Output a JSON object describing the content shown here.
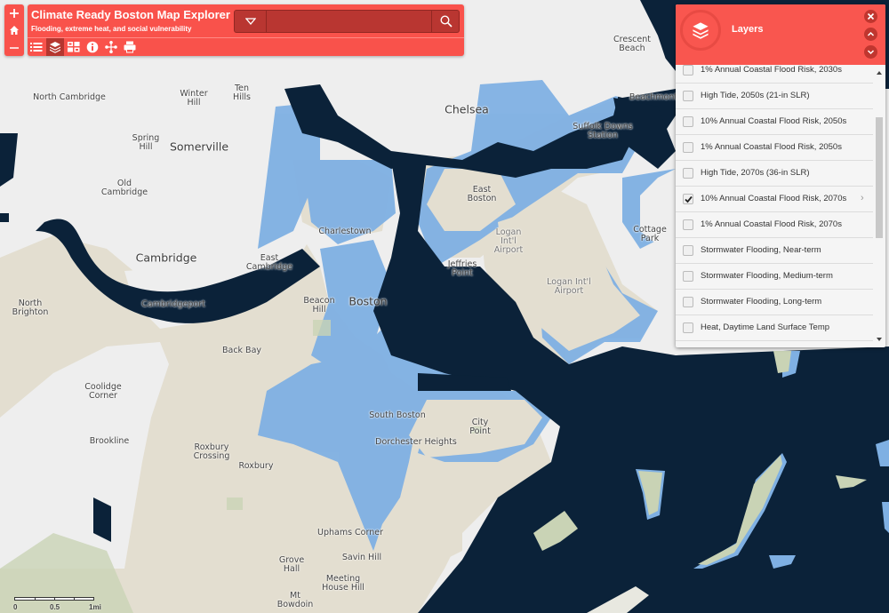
{
  "app": {
    "title": "Climate Ready Boston Map Explorer",
    "subtitle": "Flooding, extreme heat, and social vulnerability",
    "accent_color": "#f9524b",
    "accent_dark": "#b5362f"
  },
  "zoom_control": {
    "zoom_in_icon": "plus-icon",
    "home_icon": "home-icon",
    "zoom_out_icon": "minus-icon"
  },
  "search": {
    "value": "",
    "placeholder": "",
    "dropdown_icon": "triangle-down-icon",
    "search_icon": "magnifier-icon"
  },
  "toolbar": {
    "tools": [
      {
        "name": "legend",
        "icon": "list-icon",
        "active": false
      },
      {
        "name": "layers",
        "icon": "layers-icon",
        "active": true
      },
      {
        "name": "basemap",
        "icon": "grid-icon",
        "active": false
      },
      {
        "name": "about",
        "icon": "info-icon",
        "active": false
      },
      {
        "name": "share",
        "icon": "share-icon",
        "active": false
      },
      {
        "name": "print",
        "icon": "print-icon",
        "active": false
      }
    ]
  },
  "layers_panel": {
    "title": "Layers",
    "header_icon": "layers-icon",
    "close_icon": "close-icon",
    "up_icon": "chevron-up-icon",
    "down_icon": "chevron-down-icon",
    "items": [
      {
        "label": "1% Annual Coastal Flood Risk, 2030s",
        "checked": false,
        "partially_hidden": true
      },
      {
        "label": "High Tide, 2050s (21-in SLR)",
        "checked": false
      },
      {
        "label": "10% Annual Coastal Flood Risk, 2050s",
        "checked": false
      },
      {
        "label": "1% Annual Coastal Flood Risk, 2050s",
        "checked": false
      },
      {
        "label": "High Tide, 2070s (36-in SLR)",
        "checked": false
      },
      {
        "label": "10% Annual Coastal Flood Risk, 2070s",
        "checked": true,
        "has_submenu": true
      },
      {
        "label": "1% Annual Coastal Flood Risk, 2070s",
        "checked": false
      },
      {
        "label": "Stormwater Flooding, Near-term",
        "checked": false
      },
      {
        "label": "Stormwater Flooding, Medium-term",
        "checked": false
      },
      {
        "label": "Stormwater Flooding, Long-term",
        "checked": false
      },
      {
        "label": "Heat, Daytime Land Surface Temp",
        "checked": false
      }
    ],
    "submenu_arrow": "›"
  },
  "map": {
    "colors": {
      "water": "#0b2239",
      "land_boston": "#e3ded0",
      "land_other": "#eeeeee",
      "flood": "#7fb0e3",
      "park": "#c9d3b5"
    },
    "labels": [
      {
        "text": "North Cambridge",
        "size": "normal"
      },
      {
        "text": "Winter\nHill",
        "size": "normal"
      },
      {
        "text": "Ten\nHills",
        "size": "normal"
      },
      {
        "text": "Spring\nHill",
        "size": "normal"
      },
      {
        "text": "Somerville",
        "size": "big"
      },
      {
        "text": "Old\nCambridge",
        "size": "normal"
      },
      {
        "text": "Cambridge",
        "size": "big"
      },
      {
        "text": "East\nCambridge",
        "size": "normal"
      },
      {
        "text": "Charlestown",
        "size": "normal"
      },
      {
        "text": "Chelsea",
        "size": "big"
      },
      {
        "text": "Crescent\nBeach",
        "size": "normal"
      },
      {
        "text": "Beachmont",
        "size": "normal"
      },
      {
        "text": "Suffolk Downs\nStation",
        "size": "normal"
      },
      {
        "text": "East\nBoston",
        "size": "normal"
      },
      {
        "text": "Logan\nInt'l\nAirport",
        "size": "grey"
      },
      {
        "text": "Logan Int'l\nAirport",
        "size": "grey"
      },
      {
        "text": "Jeffries\nPoint",
        "size": "normal"
      },
      {
        "text": "Cottage\nPark",
        "size": "normal"
      },
      {
        "text": "Beacon\nHill",
        "size": "normal"
      },
      {
        "text": "Boston",
        "size": "big"
      },
      {
        "text": "North\nBrighton",
        "size": "normal"
      },
      {
        "text": "Cambridgeport",
        "size": "normal"
      },
      {
        "text": "Back Bay",
        "size": "normal"
      },
      {
        "text": "Coolidge\nCorner",
        "size": "normal"
      },
      {
        "text": "Brookline",
        "size": "normal"
      },
      {
        "text": "Roxbury\nCrossing",
        "size": "normal"
      },
      {
        "text": "Roxbury",
        "size": "normal"
      },
      {
        "text": "South Boston",
        "size": "normal"
      },
      {
        "text": "City\nPoint",
        "size": "normal"
      },
      {
        "text": "Dorchester Heights",
        "size": "normal"
      },
      {
        "text": "Uphams Corner",
        "size": "normal"
      },
      {
        "text": "Savin Hill",
        "size": "normal"
      },
      {
        "text": "Grove\nHall",
        "size": "normal"
      },
      {
        "text": "Meeting\nHouse Hill",
        "size": "normal"
      },
      {
        "text": "Mt\nBowdoin",
        "size": "normal"
      }
    ]
  },
  "scale_bar": {
    "labels": [
      "0",
      "0.5",
      "1mi"
    ]
  }
}
